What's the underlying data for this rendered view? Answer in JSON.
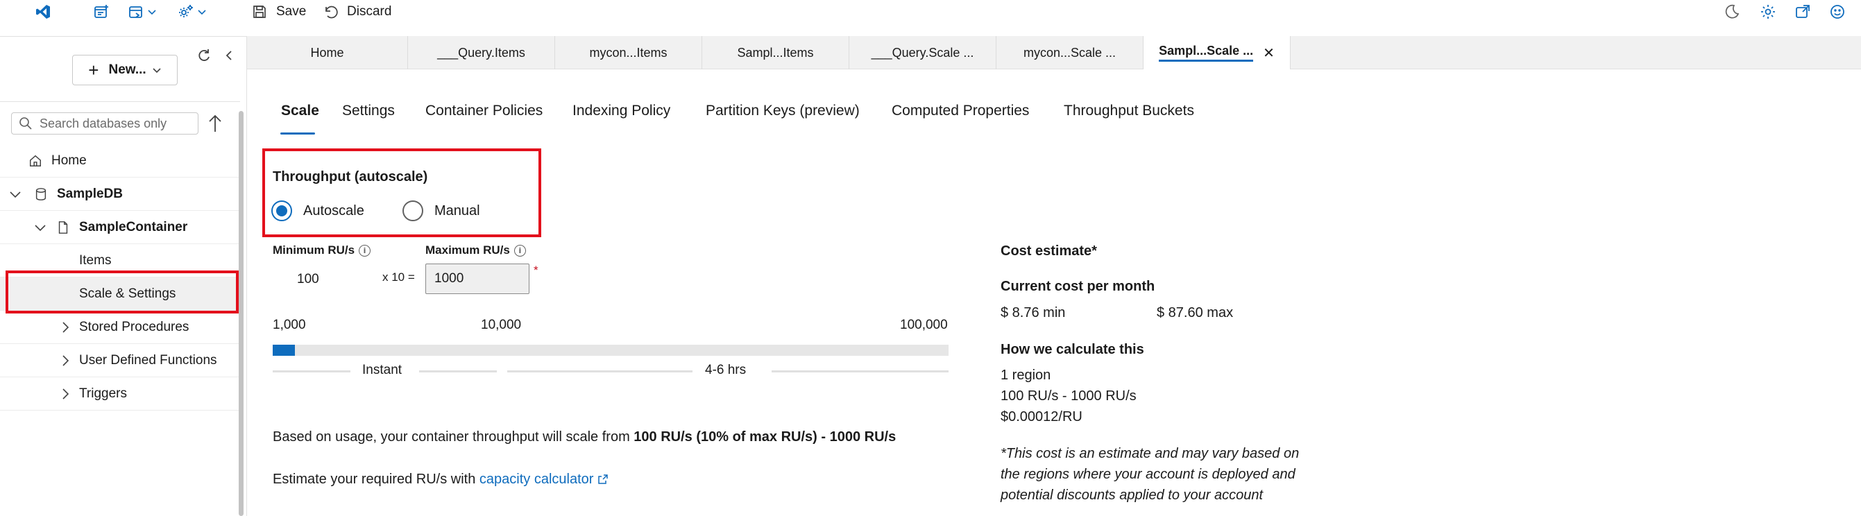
{
  "toolbar": {
    "save_label": "Save",
    "discard_label": "Discard"
  },
  "sidebar": {
    "new_label": "New...",
    "search_placeholder": "Search databases only",
    "items": {
      "home": "Home",
      "db": "SampleDB",
      "container": "SampleContainer",
      "items": "Items",
      "scale": "Scale & Settings",
      "sprocs": "Stored Procedures",
      "udfs": "User Defined Functions",
      "triggers": "Triggers"
    }
  },
  "tabs": [
    {
      "label": "Home"
    },
    {
      "label": "___Query.Items"
    },
    {
      "label": "mycon...Items"
    },
    {
      "label": "Sampl...Items"
    },
    {
      "label": "___Query.Scale ..."
    },
    {
      "label": "mycon...Scale ..."
    },
    {
      "label": "Sampl...Scale ..."
    }
  ],
  "settings_tabs": {
    "scale": "Scale",
    "settings": "Settings",
    "container_policies": "Container Policies",
    "indexing": "Indexing Policy",
    "partition": "Partition Keys (preview)",
    "computed": "Computed Properties",
    "buckets": "Throughput Buckets"
  },
  "throughput": {
    "title": "Throughput (autoscale)",
    "autoscale": "Autoscale",
    "manual": "Manual",
    "selected": "Autoscale",
    "min_label": "Minimum RU/s",
    "max_label": "Maximum RU/s",
    "min_value": "100",
    "multiplier": "x 10 =",
    "max_value": "1000",
    "required_mark": "*"
  },
  "slider": {
    "ticks": [
      "1,000",
      "10,000",
      "100,000"
    ],
    "fill_fraction": 0.033,
    "speed_instant": "Instant",
    "speed_slow": "4-6 hrs"
  },
  "usage": {
    "prefix": "Based on usage, your container throughput will scale from ",
    "range": "100 RU/s (10% of max RU/s) - 1000 RU/s",
    "estimate_prefix": "Estimate your required RU/s with ",
    "calculator_link": "capacity calculator"
  },
  "cost": {
    "title": "Cost estimate*",
    "current_title": "Current cost per month",
    "min": "$ 8.76 min",
    "max": "$ 87.60 max",
    "how_title": "How we calculate this",
    "region": "1 region",
    "ru_range": "100 RU/s - 1000 RU/s",
    "rate": "$0.00012/RU",
    "disclaimer_1": "*This cost is an estimate and may vary based on",
    "disclaimer_2": "the regions where your account is deployed and",
    "disclaimer_3": "potential discounts applied to your account"
  },
  "colors": {
    "accent": "#0f6cbd",
    "highlight": "#e3101c"
  }
}
